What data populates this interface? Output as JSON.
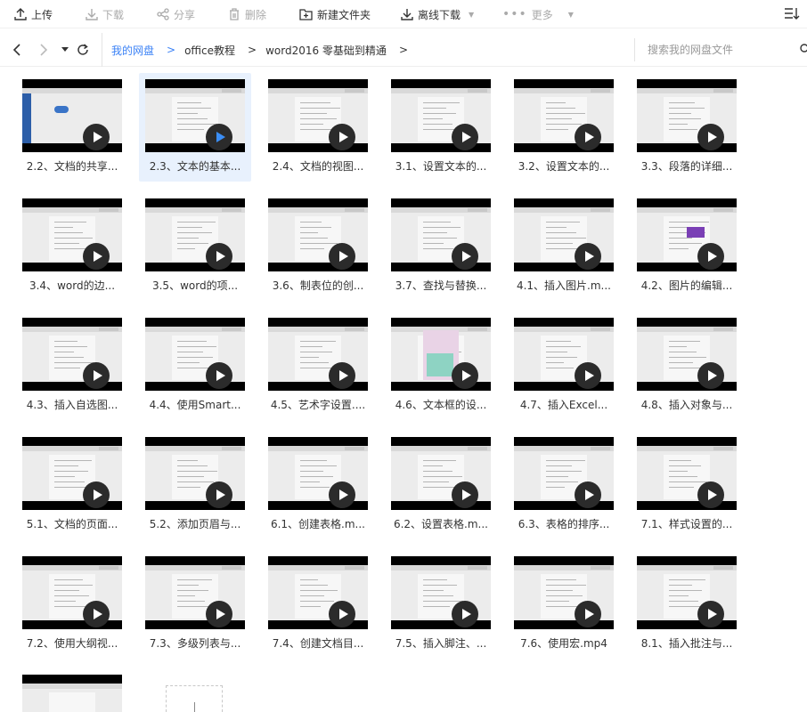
{
  "toolbar": {
    "upload": "上传",
    "download": "下载",
    "share": "分享",
    "delete": "删除",
    "new_folder": "新建文件夹",
    "offline_download": "离线下载",
    "more": "更多"
  },
  "breadcrumb": {
    "root": "我的网盘",
    "level1": "office教程",
    "level2": "word2016 零基础到精通",
    "sep": ">"
  },
  "search": {
    "placeholder": "搜索我的网盘文件"
  },
  "files": [
    {
      "name": "2.2、文档的共享..."
    },
    {
      "name": "2.3、文本的基本...",
      "selected": true
    },
    {
      "name": "2.4、文档的视图..."
    },
    {
      "name": "3.1、设置文本的..."
    },
    {
      "name": "3.2、设置文本的..."
    },
    {
      "name": "3.3、段落的详细..."
    },
    {
      "name": "3.4、word的边..."
    },
    {
      "name": "3.5、word的项..."
    },
    {
      "name": "3.6、制表位的创..."
    },
    {
      "name": "3.7、查找与替换..."
    },
    {
      "name": "4.1、插入图片.m..."
    },
    {
      "name": "4.2、图片的编辑..."
    },
    {
      "name": "4.3、插入自选图..."
    },
    {
      "name": "4.4、使用Smart..."
    },
    {
      "name": "4.5、艺术字设置...."
    },
    {
      "name": "4.6、文本框的设..."
    },
    {
      "name": "4.7、插入Excel..."
    },
    {
      "name": "4.8、插入对象与..."
    },
    {
      "name": "5.1、文档的页面..."
    },
    {
      "name": "5.2、添加页眉与..."
    },
    {
      "name": "6.1、创建表格.m..."
    },
    {
      "name": "6.2、设置表格.m..."
    },
    {
      "name": "6.3、表格的排序..."
    },
    {
      "name": "7.1、样式设置的..."
    },
    {
      "name": "7.2、使用大纲视..."
    },
    {
      "name": "7.3、多级列表与..."
    },
    {
      "name": "7.4、创建文档目..."
    },
    {
      "name": "7.5、插入脚注、..."
    },
    {
      "name": "7.6、使用宏.mp4"
    },
    {
      "name": "8.1、插入批注与..."
    }
  ],
  "colors": {
    "accent": "#3b82f6",
    "play_selected": "#3b8ef5",
    "selected_bg": "#e8f1fd"
  }
}
